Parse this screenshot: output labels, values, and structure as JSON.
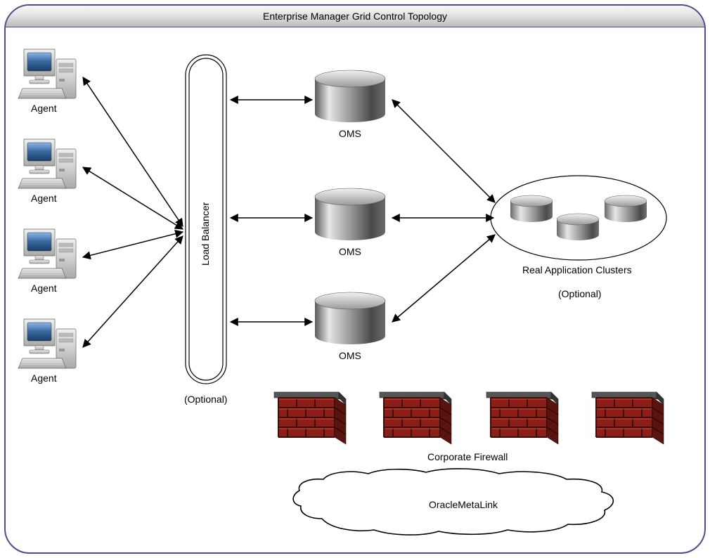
{
  "title": "Enterprise Manager Grid Control Topology",
  "agents": {
    "label": "Agent",
    "count": 4
  },
  "load_balancer": {
    "label": "Load Balancer",
    "note": "(Optional)"
  },
  "oms": {
    "label": "OMS",
    "count": 3
  },
  "rac": {
    "label": "Real Application Clusters",
    "note": "(Optional)"
  },
  "firewall": {
    "label": "Corporate Firewall",
    "count": 4
  },
  "cloud": {
    "label": "OracleMetaLink"
  }
}
